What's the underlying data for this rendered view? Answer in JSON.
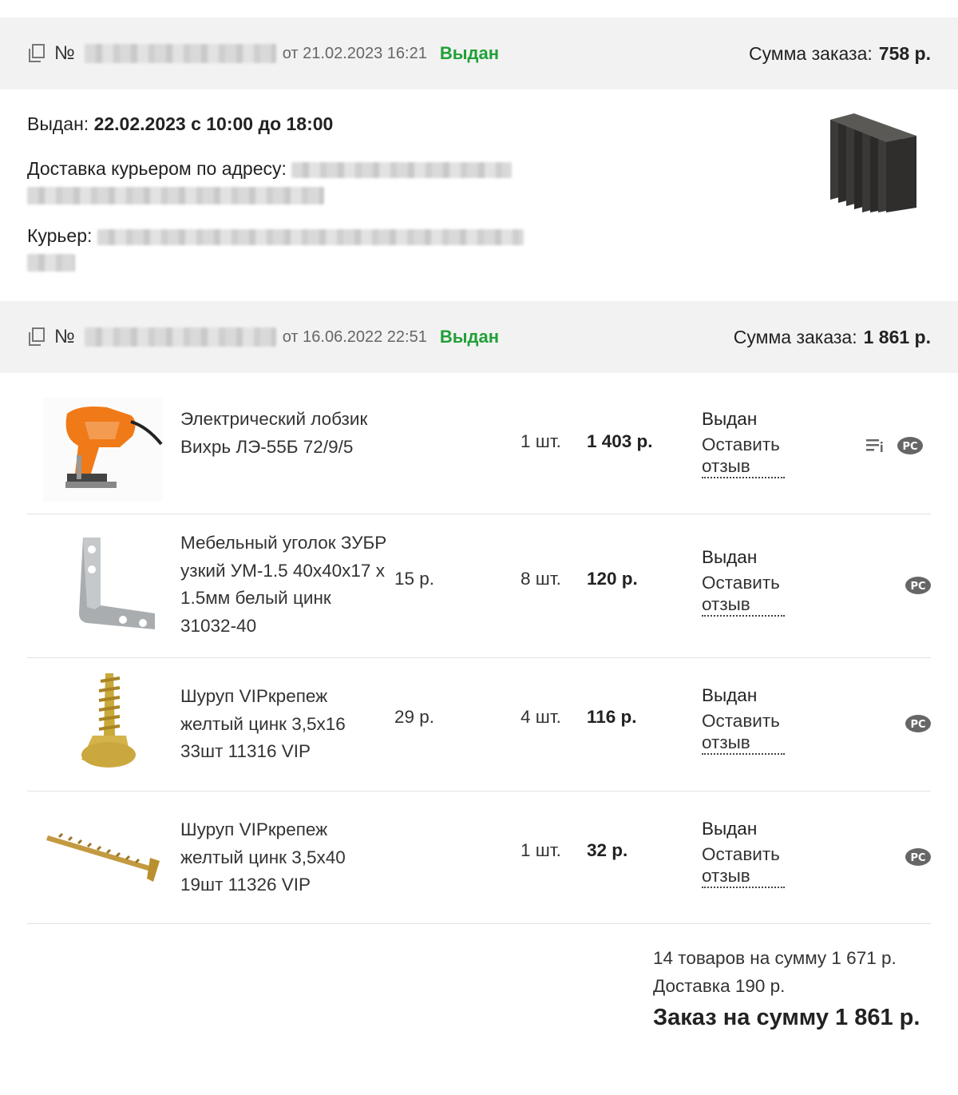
{
  "orders": [
    {
      "number_sign": "№",
      "date": "от 21.02.2023 16:21",
      "status": "Выдан",
      "sum_label": "Сумма заказа:",
      "sum_value": "758 р."
    },
    {
      "number_sign": "№",
      "date": "от 16.06.2022 22:51",
      "status": "Выдан",
      "sum_label": "Сумма заказа:",
      "sum_value": "1 861 р."
    }
  ],
  "delivery": {
    "issued_label": "Выдан:",
    "issued_value": "22.02.2023 с 10:00 до 18:00",
    "address_label": "Доставка курьером по адресу:",
    "courier_label": "Курьер:"
  },
  "items": [
    {
      "name": "Электрический лобзик Вихрь ЛЭ-55Б 72/9/5",
      "unit_price": "",
      "qty": "1 шт.",
      "total": "1 403 р.",
      "status": "Выдан",
      "review": "Оставить отзыв",
      "icons": [
        "list-icon",
        "rst-certificate-icon"
      ]
    },
    {
      "name": "Мебельный уголок ЗУБР узкий УМ-1.5 40х40х17 х 1.5мм белый цинк 31032-40",
      "unit_price": "15 р.",
      "qty": "8 шт.",
      "total": "120 р.",
      "status": "Выдан",
      "review": "Оставить отзыв",
      "icons": [
        "rst-certificate-icon"
      ]
    },
    {
      "name": "Шуруп VIPкрепеж желтый цинк 3,5х16 33шт 11316 VIP",
      "unit_price": "29 р.",
      "qty": "4 шт.",
      "total": "116 р.",
      "status": "Выдан",
      "review": "Оставить отзыв",
      "icons": [
        "rst-certificate-icon"
      ]
    },
    {
      "name": "Шуруп VIPкрепеж желтый цинк 3,5х40 19шт 11326 VIP",
      "unit_price": "",
      "qty": "1 шт.",
      "total": "32 р.",
      "status": "Выдан",
      "review": "Оставить отзыв",
      "icons": [
        "rst-certificate-icon"
      ]
    }
  ],
  "summary": {
    "items_line": "14 товаров на сумму 1 671 р.",
    "delivery_line": "Доставка 190 р.",
    "total_line": "Заказ на сумму 1 861 р."
  },
  "colors": {
    "status_green": "#21a038",
    "header_bg": "#f2f2f2",
    "divider": "#e3e3e3"
  }
}
